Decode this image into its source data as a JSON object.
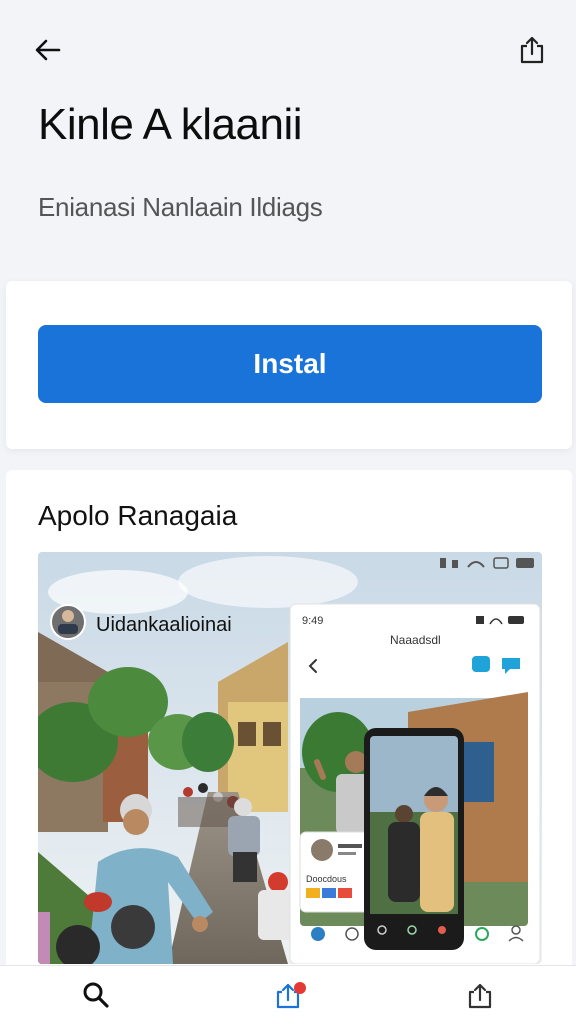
{
  "header": {
    "back_icon": "arrow-left-icon",
    "share_icon": "share-icon"
  },
  "app": {
    "title": "Kinle A klaanii",
    "subtitle": "Enianasi Nanlaain Ildiags",
    "install_label": "Instal",
    "accent_color": "#1a73d9"
  },
  "screenshots": {
    "section_title": "Apolo Ranagaia",
    "profile_name": "Uidankaalioinai",
    "phone_header": "Naaadsdl",
    "phone_time": "9:49",
    "status_time": "",
    "caption": "Doocdous"
  },
  "bottom_nav": {
    "items": [
      {
        "icon": "search-icon"
      },
      {
        "icon": "updates-icon",
        "badge": true
      },
      {
        "icon": "library-icon"
      }
    ],
    "badge_color": "#e53935"
  }
}
